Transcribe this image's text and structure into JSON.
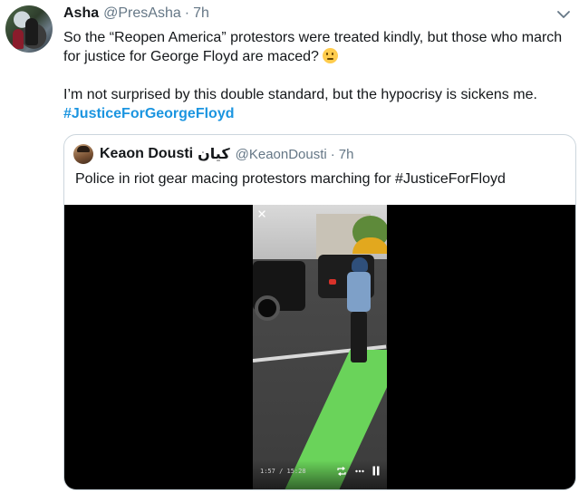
{
  "tweet": {
    "author_name": "Asha",
    "author_handle": "@PresAsha",
    "separator": "·",
    "time": "7h",
    "line1": "So the “Reopen America” protestors were treated kindly, but those who march for justice for George Floyd are maced?",
    "emoji_icon": "thinking-face-icon",
    "line2": "I’m not surprised by this double standard, but the hypocrisy is sickens me.",
    "hashtag": "#JusticeForGeorgeFloyd"
  },
  "quoted_tweet": {
    "author_name": "Keaon Dousti",
    "author_name_arabic": "كيان",
    "author_handle": "@KeaonDousti",
    "separator": "·",
    "time": "7h",
    "text": "Police in riot gear macing protestors marching for #JusticeForFloyd"
  },
  "video": {
    "time_display": "1:57 / 15:28",
    "controls": [
      "loop-icon",
      "more-icon",
      "pause-icon"
    ]
  },
  "colors": {
    "text": "#14171a",
    "secondary": "#657786",
    "link": "#1b95e0",
    "border": "#ccd6dd"
  }
}
